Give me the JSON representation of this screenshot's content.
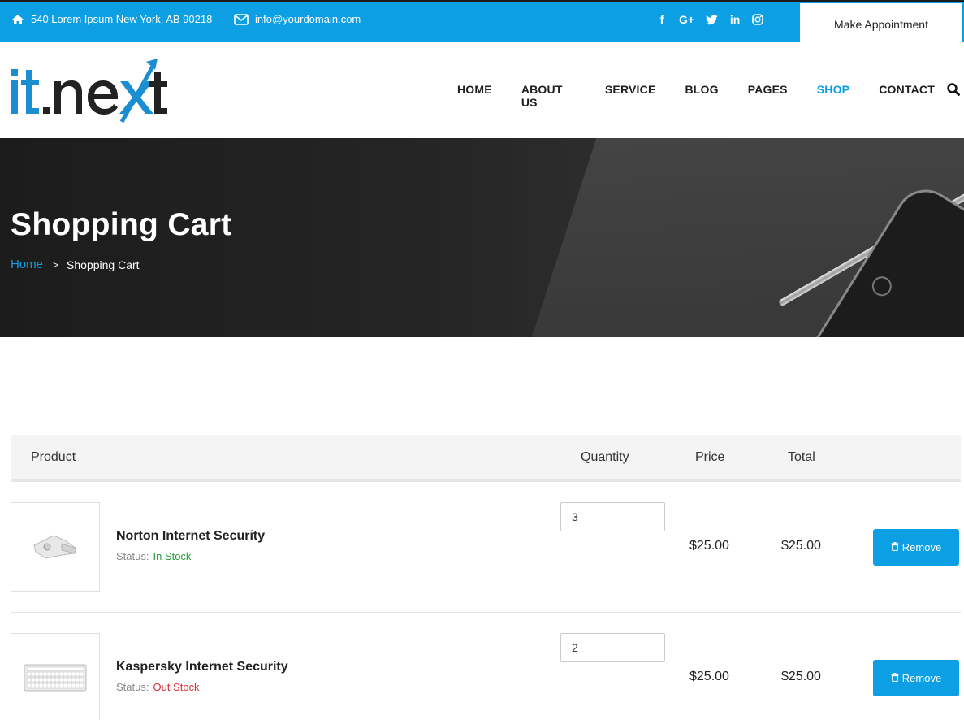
{
  "topbar": {
    "address": "540 Lorem Ipsum New York, AB 90218",
    "email": "info@yourdomain.com",
    "social": [
      {
        "icon": "facebook-icon",
        "glyph": "f"
      },
      {
        "icon": "google-plus-icon",
        "glyph": "G+"
      },
      {
        "icon": "twitter-icon",
        "glyph": "t"
      },
      {
        "icon": "linkedin-icon",
        "glyph": "in"
      },
      {
        "icon": "instagram-icon",
        "glyph": "◎"
      }
    ],
    "appointment_label": "Make Appointment"
  },
  "header": {
    "nav": [
      "HOME",
      "ABOUT US",
      "SERVICE",
      "BLOG",
      "PAGES",
      "SHOP",
      "CONTACT"
    ],
    "active": "SHOP"
  },
  "banner": {
    "title": "Shopping Cart",
    "breadcrumb_home": "Home",
    "breadcrumb_sep": ">",
    "breadcrumb_current": "Shopping Cart"
  },
  "cart": {
    "headers": {
      "product": "Product",
      "quantity": "Quantity",
      "price": "Price",
      "total": "Total"
    },
    "status_label": "Status:",
    "remove_label": "Remove",
    "items": [
      {
        "name": "Norton Internet Security",
        "status": "In Stock",
        "quantity": "3",
        "price": "$25.00",
        "total": "$25.00"
      },
      {
        "name": "Kaspersky Internet Security",
        "status": "Out Stock",
        "quantity": "2",
        "price": "$25.00",
        "total": "$25.00"
      }
    ]
  },
  "colors": {
    "accent": "#0d9fe3",
    "in_stock": "#2a9d3c",
    "out_stock": "#d9303a"
  }
}
